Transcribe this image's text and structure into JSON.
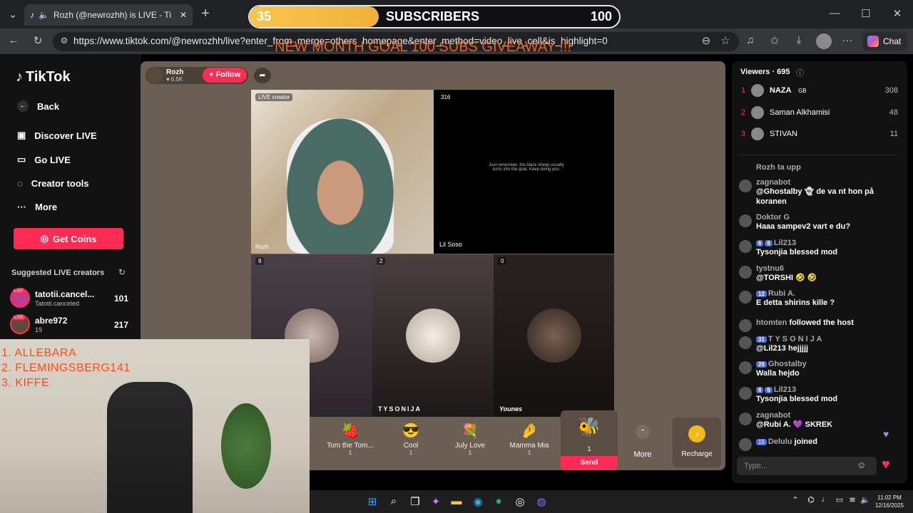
{
  "browser": {
    "tab_title": "Rozh (@newrozhh) is LIVE - Ti",
    "url": "https://www.tiktok.com/@newrozhh/live?enter_from_merge=others_homepage&enter_method=video_live_cell&is_highlight=0",
    "chat_label": "Chat"
  },
  "overlay": {
    "current": "35",
    "label": "SUBSCRIBERS",
    "goal": "100",
    "progress": 0.35,
    "goal_text": "NEW MONTH GOAL 100 SUBS GIVEAWAY !!!"
  },
  "nav": {
    "logo": "TikTok",
    "back": "Back",
    "discover": "Discover LIVE",
    "golive": "Go LIVE",
    "creator": "Creator tools",
    "more": "More",
    "coins": "Get Coins",
    "suggested": "Suggested LIVE creators",
    "creators": [
      {
        "name": "tatotii.cancel...",
        "sub": "Tatotii.canceled",
        "count": "101",
        "badge": "LIVE"
      },
      {
        "name": "abre972",
        "sub": "19",
        "count": "217",
        "badge": "LIVE"
      }
    ]
  },
  "host": {
    "name": "Rozh",
    "likes": "6.5K",
    "follow": "+ Follow"
  },
  "tiles": {
    "main_label": "LIVE creator",
    "main_name": "Rozh",
    "soso_count": "316",
    "soso_name": "Lil Soso",
    "soso_text": "Just remember, the black sheep usually turns into the goat. Keep doing you.",
    "g1_count": "8",
    "g2_count": "2",
    "g2_name": "TYSONIJA",
    "g3_count": "0",
    "g3_name": "Younes"
  },
  "gifts": [
    {
      "name": "Tom the Tom...",
      "price": "1",
      "icon": "🍓"
    },
    {
      "name": "Cool",
      "price": "1",
      "icon": "😎"
    },
    {
      "name": "July Love",
      "price": "1",
      "icon": "💐"
    },
    {
      "name": "Mamma Mia",
      "price": "1",
      "icon": "🤌"
    }
  ],
  "gift_selected": {
    "price": "1",
    "send": "Send",
    "icon": "🐝"
  },
  "gift_more": "More",
  "recharge": "Recharge",
  "viewers": {
    "label": "Viewers · 695",
    "list": [
      {
        "rank": "1",
        "name": "NAZA",
        "tag": "GB",
        "count": "308"
      },
      {
        "rank": "2",
        "name": "Saman Alkhamisi",
        "count": "48"
      },
      {
        "rank": "3",
        "name": "STIVAN",
        "count": "11"
      }
    ]
  },
  "chat": [
    {
      "user": "Rozh ta upp",
      "text": ""
    },
    {
      "user": "zagnabot",
      "text": "@Ghostalby 👻 de va nt hon på koranen"
    },
    {
      "user": "Doktor G",
      "text": "Haaa sampev2 vart e du?"
    },
    {
      "user": "Lil213",
      "badges": [
        "6",
        "6"
      ],
      "text": "Tysonjia blessed mod"
    },
    {
      "user": "tystnu6",
      "text": "@TORSHI 🤣 🤣"
    },
    {
      "user": "Rubi A.",
      "badges": [
        "12"
      ],
      "text": "E detta shirins kille ?"
    },
    {
      "user": "htomten",
      "text": "followed the host"
    },
    {
      "user": "T Y S O N I J A",
      "badges": [
        "31"
      ],
      "text": "@Lil213 hejjjjj"
    },
    {
      "user": "Ghostalby",
      "badges": [
        "26"
      ],
      "text": "Walla hejdo"
    },
    {
      "user": "Lil213",
      "badges": [
        "6",
        "6"
      ],
      "text": "Tysonjia blessed mod"
    },
    {
      "user": "zagnabot",
      "text": "@Rubi A. 💜 SKREK"
    },
    {
      "user": "Delulu",
      "badges": [
        "15"
      ],
      "text": "joined"
    }
  ],
  "chat_placeholder": "Type...",
  "cam_list": [
    "1.  ALLEBARA",
    "2.  FLEMINGSBERG141",
    "3.  KIFFE"
  ],
  "taskbar": {
    "time": "11:02 PM",
    "date": "12/16/2025"
  }
}
